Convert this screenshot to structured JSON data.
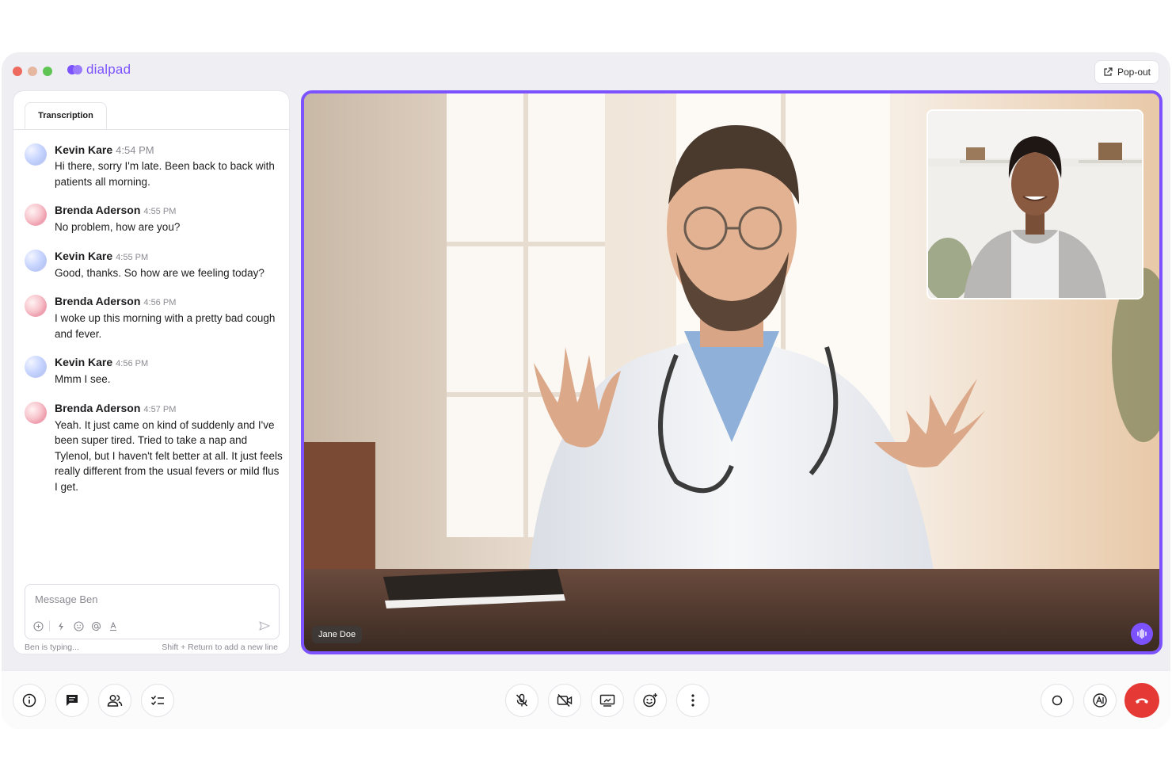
{
  "app": {
    "logo_text": "dialpad",
    "brand_color": "#7c52ff",
    "popout_label": "Pop-out"
  },
  "transcription": {
    "tab_label": "Transcription",
    "messages": [
      {
        "name": "Kevin Kare",
        "time": "4:54 PM",
        "text": "Hi there, sorry I'm late. Been back to back with patients all morning.",
        "avatar": "kevin"
      },
      {
        "name": "Brenda Aderson",
        "time": "4:55 PM",
        "text": "No problem, how are you?",
        "avatar": "brenda"
      },
      {
        "name": "Kevin Kare",
        "time": "4:55 PM",
        "text": "Good, thanks. So how are we feeling today?",
        "avatar": "kevin"
      },
      {
        "name": "Brenda Aderson",
        "time": "4:56 PM",
        "text": "I woke up this morning with a pretty bad cough and fever.",
        "avatar": "brenda"
      },
      {
        "name": "Kevin Kare",
        "time": "4:56 PM",
        "text": "Mmm I see.",
        "avatar": "kevin"
      },
      {
        "name": "Brenda Aderson",
        "time": "4:57 PM",
        "text": "Yeah. It just came on kind of suddenly and I've been super tired. Tried to take a nap and Tylenol, but I haven't felt better at all. It just feels really different from the usual fevers or mild flus I get.",
        "avatar": "brenda"
      }
    ],
    "composer": {
      "placeholder": "Message Ben",
      "typing_status": "Ben is typing...",
      "hint": "Shift + Return to add a new line"
    }
  },
  "video": {
    "participant_label": "Jane Doe"
  },
  "controls": {
    "left": [
      "info-icon",
      "chat-icon",
      "participants-icon",
      "tasks-icon"
    ],
    "center": [
      "mic-off-icon",
      "video-off-icon",
      "screen-share-icon",
      "reactions-icon",
      "more-icon"
    ],
    "right": [
      "record-icon",
      "ai-icon",
      "end-call-icon"
    ],
    "end_call_color": "#e53935"
  }
}
